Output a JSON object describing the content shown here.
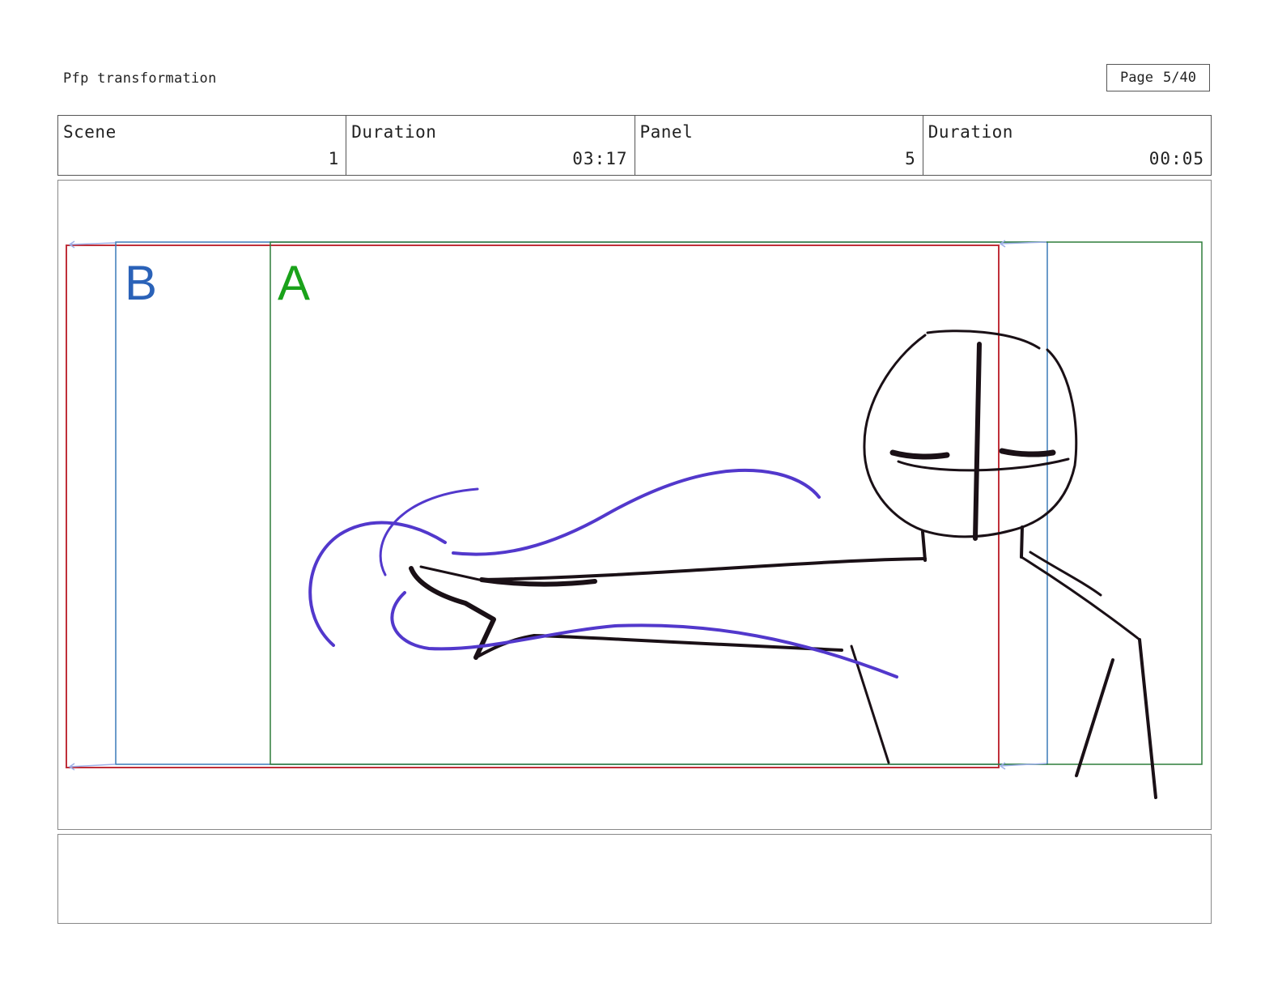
{
  "header": {
    "title": "Pfp transformation",
    "page_label": "Page",
    "page_value": "5/40"
  },
  "info": {
    "scene_label": "Scene",
    "scene_value": "1",
    "scene_duration_label": "Duration",
    "scene_duration_value": "03:17",
    "panel_label": "Panel",
    "panel_value": "5",
    "panel_duration_label": "Duration",
    "panel_duration_value": "00:05"
  },
  "panel": {
    "field_b": "B",
    "field_a": "A",
    "colors": {
      "red_field": "#c0303a",
      "blue_field": "#3a7ab8",
      "green_field": "#2e7d3a",
      "label_b": "#2a62b8",
      "label_a": "#1aa21a",
      "sketch_black": "#1a1016",
      "sketch_purple": "#5238cc"
    }
  },
  "notes": {
    "text": ""
  }
}
